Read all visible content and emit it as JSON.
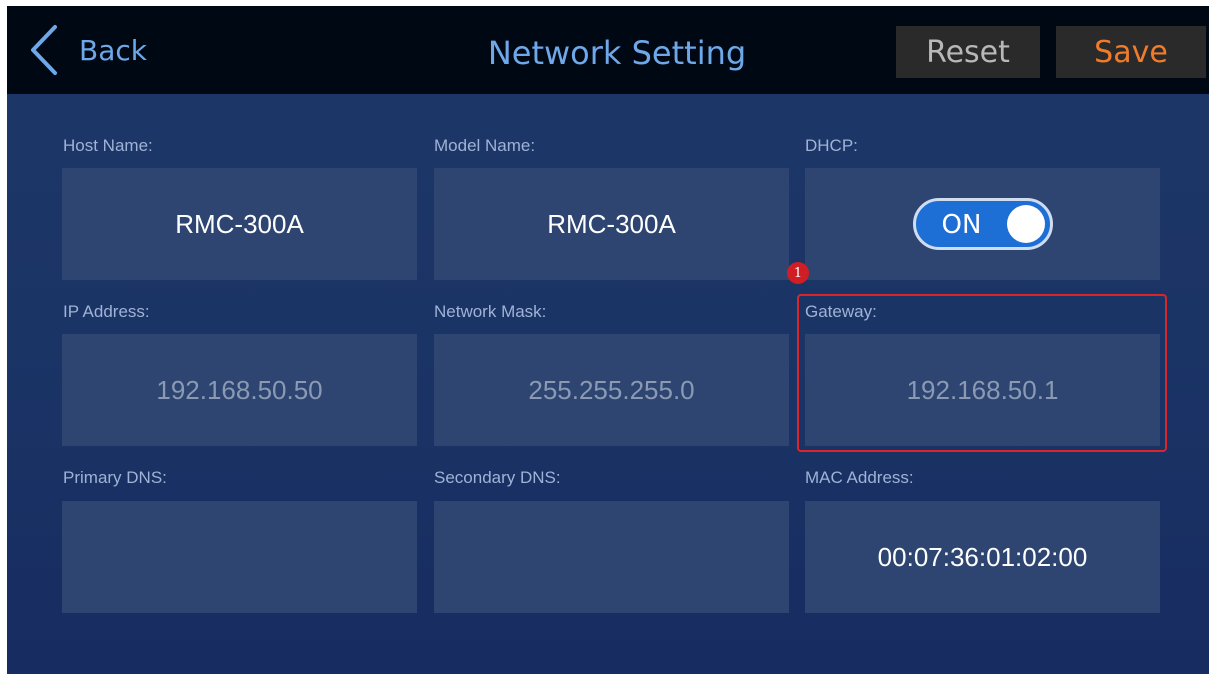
{
  "header": {
    "back_label": "Back",
    "title": "Network Setting",
    "reset_label": "Reset",
    "save_label": "Save"
  },
  "colors": {
    "accent_text": "#6ea8e8",
    "save_text": "#f07c2a",
    "toggle_on": "#1d6fd6",
    "highlight": "#d8262b"
  },
  "fields": {
    "host_name": {
      "label": "Host Name:",
      "value": "RMC-300A"
    },
    "model_name": {
      "label": "Model Name:",
      "value": "RMC-300A"
    },
    "dhcp": {
      "label": "DHCP:",
      "toggle_label": "ON",
      "state": "on"
    },
    "ip_address": {
      "label": "IP Address:",
      "value": "192.168.50.50"
    },
    "network_mask": {
      "label": "Network Mask:",
      "value": "255.255.255.0"
    },
    "gateway": {
      "label": "Gateway:",
      "value": "192.168.50.1"
    },
    "primary_dns": {
      "label": "Primary DNS:",
      "value": ""
    },
    "secondary_dns": {
      "label": "Secondary DNS:",
      "value": ""
    },
    "mac_address": {
      "label": "MAC Address:",
      "value": "00:07:36:01:02:00"
    }
  },
  "annotation": {
    "marker": "1"
  },
  "icons": {
    "back": "chevron-left-icon"
  }
}
